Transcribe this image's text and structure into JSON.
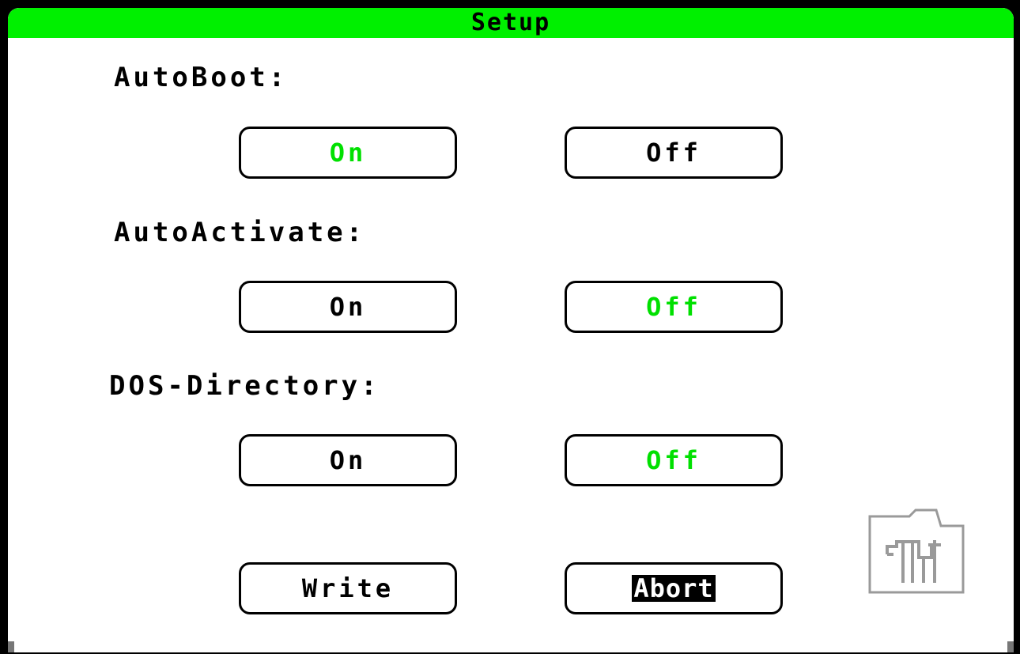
{
  "window": {
    "title": "Setup",
    "accent_color": "#00f000"
  },
  "sections": [
    {
      "label": "AutoBoot:",
      "on_label": "On",
      "off_label": "Off",
      "selected": "On"
    },
    {
      "label": "AutoActivate:",
      "on_label": "On",
      "off_label": "Off",
      "selected": "Off"
    },
    {
      "label": "DOS-Directory:",
      "on_label": "On",
      "off_label": "Off",
      "selected": "Off"
    }
  ],
  "actions": {
    "write_label": "Write",
    "abort_label": "Abort"
  },
  "icons": {
    "window_icon": "disk-tool-icon"
  }
}
